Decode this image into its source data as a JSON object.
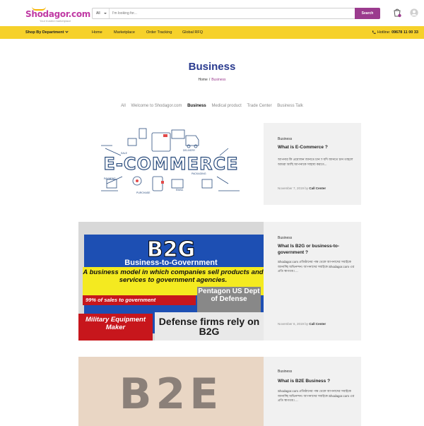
{
  "header": {
    "logo_text": "Shodagor.com",
    "logo_tagline": "Your trusted marketplace",
    "search": {
      "category": "All",
      "placeholder": "I'm looking for...",
      "button": "Search"
    }
  },
  "nav": {
    "department": "Shop By Department",
    "links": [
      "Home",
      "Marketplace",
      "Order Tracking",
      "Global RFQ"
    ],
    "hotline_label": "Hotline:",
    "hotline_number": "09678 11 00 33"
  },
  "page": {
    "title": "Business",
    "breadcrumb": {
      "home": "Home",
      "separator": "/",
      "current": "Business"
    }
  },
  "filters": [
    "All",
    "Welcome to Shodagor.com",
    "Business",
    "Medical product",
    "Trade Center",
    "Business Talk"
  ],
  "active_filter": "Business",
  "posts": [
    {
      "category": "Business",
      "title": "What is E-Commerce ?",
      "excerpt": "আপনার কি প্রয়োজন জানতে চান ? যদি জানতে চান তাহলে আমরা আছি আপনাকে সাহায্য করতে...",
      "date": "November 7, 2019",
      "by": "by",
      "author": "Call Center",
      "image_text": "E-COMMERCE",
      "image_labels": [
        "SALE",
        "DELIVERY",
        "PAYMENT",
        "PACKAGING",
        "PURCHASE",
        "EMAIL"
      ]
    },
    {
      "category": "Business",
      "title": "What Is B2G or business-to-government ?",
      "excerpt": "Shodagor.com প্রতিষ্ঠানের পক্ষ থেকে আপনাদের সবাইকে জানাচ্ছি অভিনন্দন। আপনাদের সবাইকে Shodagor.com এর প্রতি স্বাগতম। ...",
      "date": "November 6, 2019",
      "by": "by",
      "author": "Call Center",
      "image": {
        "big": "B2G",
        "sub": "Business-to-Government",
        "desc": "A business model in which companies sell products and services to government agencies.",
        "pct": "99% of sales to government",
        "pentagon": "Pentagon US Dept of Defense",
        "military": "Military Equipment Maker",
        "defense": "Defense firms rely on B2G"
      }
    },
    {
      "category": "Business",
      "title": "What is B2E Business ?",
      "excerpt": "Shodagor.com প্রতিষ্ঠানের পক্ষ থেকে আপনাদের সবাইকে জানাচ্ছি অভিনন্দন। আপনাদের সবাইকে Shodagor.com এর প্রতি স্বাগতম। ...",
      "image_text": "B2E"
    }
  ],
  "colors": {
    "brand": "#c03aa4",
    "nav_bg": "#f6d12a",
    "title": "#2a3b8f",
    "search_button": "#9b3b8e"
  }
}
